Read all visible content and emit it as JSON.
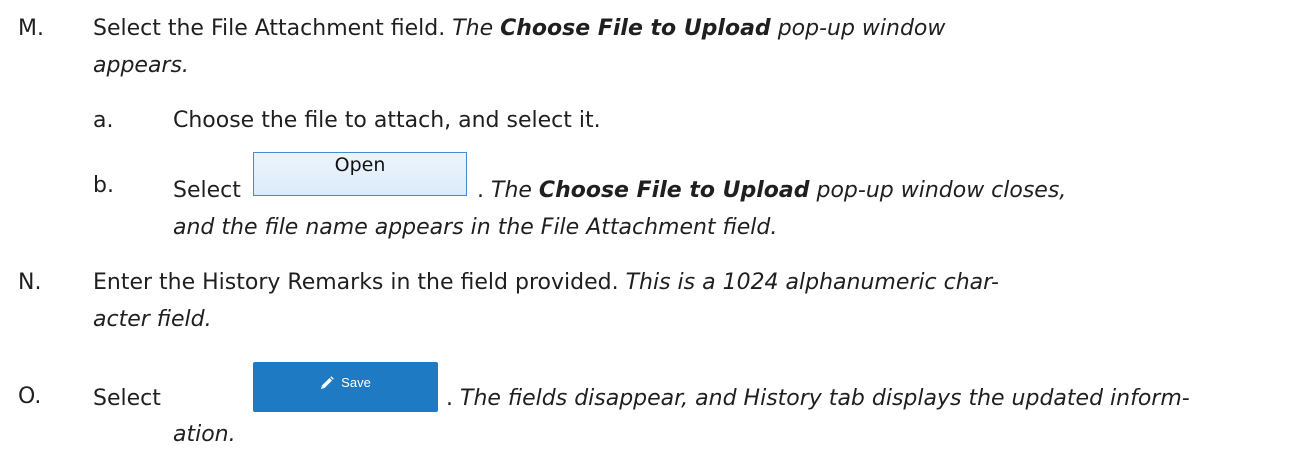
{
  "steps": [
    {
      "marker": "M.",
      "text": "Select the File Attachment field.",
      "result_pre": "The",
      "result_bold": "Choose File to Upload",
      "result_post_l1": "pop-up window",
      "result_post_l2": "appears.",
      "substeps": [
        {
          "marker": "a.",
          "text": "Choose the file to attach, and select it."
        },
        {
          "marker": "b.",
          "text_pre": "Select",
          "button_label": "Open",
          "text_post": ".",
          "result_pre": "The",
          "result_bold": "Choose File to Upload",
          "result_post_l1": "pop-up window closes,",
          "result_post_l2": "and the file name appears in the File Attachment field."
        }
      ]
    },
    {
      "marker": "N.",
      "text": "Enter the History Remarks in the field provided.",
      "result_l1": "This is a 1024 alphanumeric char-",
      "result_l2": "acter field."
    },
    {
      "marker": "O.",
      "text_pre": "Select",
      "button_label": "Save",
      "text_post": ".",
      "result_l1": "The fields disappear, and History tab displays the updated inform-",
      "result_l2": "ation."
    }
  ],
  "colors": {
    "save_button_bg": "#1f7ac4",
    "open_button_border": "#3f8fd6"
  },
  "icons": {
    "save": "pencil-icon"
  }
}
